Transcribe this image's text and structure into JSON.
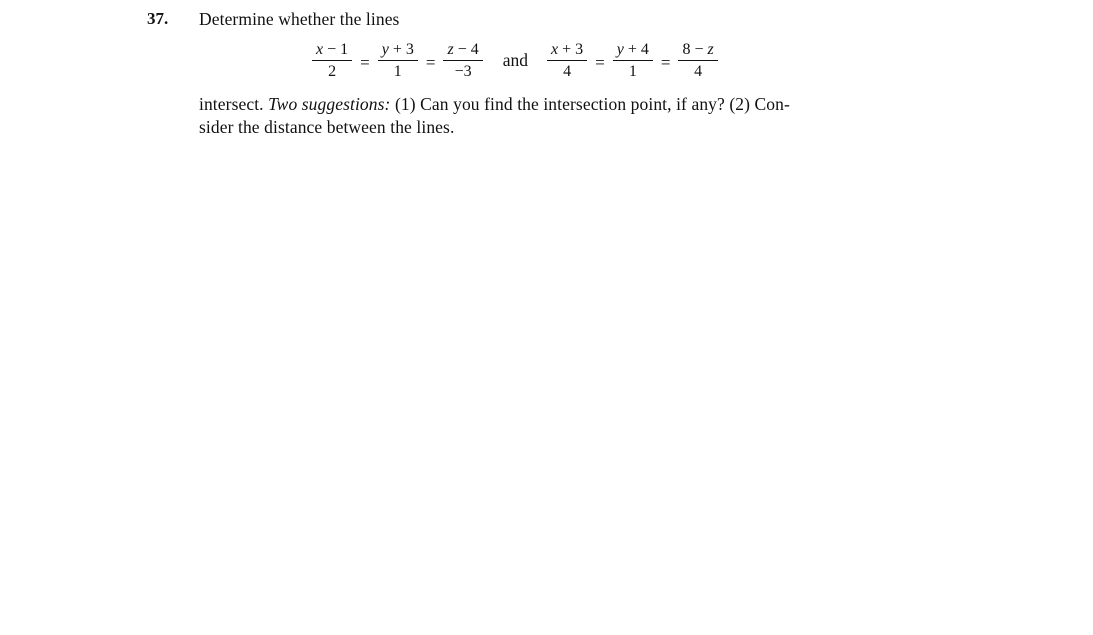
{
  "problem": {
    "number": "37.",
    "intro": "Determine whether the lines",
    "line1": {
      "fractions": [
        {
          "num_var": "x",
          "num_rest": " − 1",
          "den": "2"
        },
        {
          "num_var": "y",
          "num_rest": " + 3",
          "den": "1"
        },
        {
          "num_var": "z",
          "num_rest": " − 4",
          "den": "−3"
        }
      ]
    },
    "connector": "and",
    "line2": {
      "fractions": [
        {
          "num_var": "x",
          "num_rest": " + 3",
          "den": "4"
        },
        {
          "num_var": "y",
          "num_rest": " + 4",
          "den": "1"
        },
        {
          "num_pre": "8 − ",
          "num_var": "z",
          "den": "4"
        }
      ]
    },
    "equals": "=",
    "body_line1_start": "intersect. ",
    "body_italic": "Two suggestions:",
    "body_line1_end": " (1) Can you find the intersection point, if any? (2) Con-",
    "body_line2": "sider the distance between the lines."
  }
}
